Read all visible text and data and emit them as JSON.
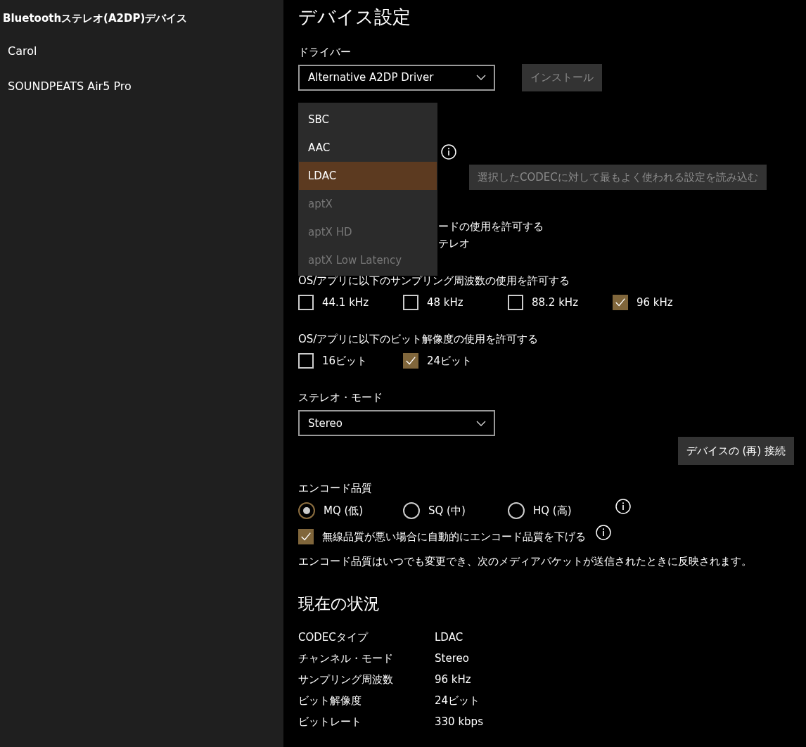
{
  "sidebar": {
    "title": "Bluetoothステレオ(A2DP)デバイス",
    "items": [
      {
        "label": "Carol"
      },
      {
        "label": "SOUNDPEATS Air5 Pro"
      }
    ]
  },
  "settings": {
    "title": "デバイス設定",
    "driver_label": "ドライバー",
    "driver": {
      "value": "Alternative A2DP Driver"
    },
    "install_button": {
      "label": "インストール",
      "disabled": true
    },
    "codec_popup": {
      "options": [
        {
          "label": "SBC",
          "selected": false,
          "disabled": false
        },
        {
          "label": "AAC",
          "selected": false,
          "disabled": false
        },
        {
          "label": "LDAC",
          "selected": true,
          "disabled": false
        },
        {
          "label": "aptX",
          "selected": false,
          "disabled": true
        },
        {
          "label": "aptX HD",
          "selected": false,
          "disabled": true
        },
        {
          "label": "aptX Low Latency",
          "selected": false,
          "disabled": true
        }
      ]
    },
    "load_button": {
      "label": "選択したCODECに対して最もよく使われる設定を読み込む",
      "disabled": true
    },
    "partial_lines": [
      "ードの使用を許可する",
      "テレオ"
    ],
    "sample_rates": {
      "label": "OS/アプリに以下のサンプリング周波数の使用を許可する",
      "options": [
        {
          "label": "44.1 kHz",
          "checked": false
        },
        {
          "label": "48 kHz",
          "checked": false
        },
        {
          "label": "88.2 kHz",
          "checked": false
        },
        {
          "label": "96 kHz",
          "checked": true
        }
      ]
    },
    "bit_depths": {
      "label": "OS/アプリに以下のビット解像度の使用を許可する",
      "options": [
        {
          "label": "16ビット",
          "checked": false
        },
        {
          "label": "24ビット",
          "checked": true
        }
      ]
    },
    "stereo_mode": {
      "label": "ステレオ・モード",
      "value": "Stereo"
    },
    "reconnect_button": {
      "label": "デバイスの (再) 接続"
    },
    "encode_quality": {
      "label": "エンコード品質",
      "options": [
        {
          "label": "MQ (低)",
          "selected": true
        },
        {
          "label": "SQ (中)",
          "selected": false
        },
        {
          "label": "HQ (高)",
          "selected": false
        }
      ]
    },
    "auto_lower": {
      "label": "無線品質が悪い場合に自動的にエンコード品質を下げる",
      "checked": true
    },
    "note": "エンコード品質はいつでも変更でき、次のメディアパケットが送信されたときに反映されます。"
  },
  "status": {
    "title": "現在の状況",
    "rows": [
      {
        "label": "CODECタイプ",
        "value": "LDAC"
      },
      {
        "label": "チャンネル・モード",
        "value": "Stereo"
      },
      {
        "label": "サンプリング周波数",
        "value": "96 kHz"
      },
      {
        "label": "ビット解像度",
        "value": "24ビット"
      },
      {
        "label": "ビットレート",
        "value": "330 kbps"
      }
    ]
  }
}
